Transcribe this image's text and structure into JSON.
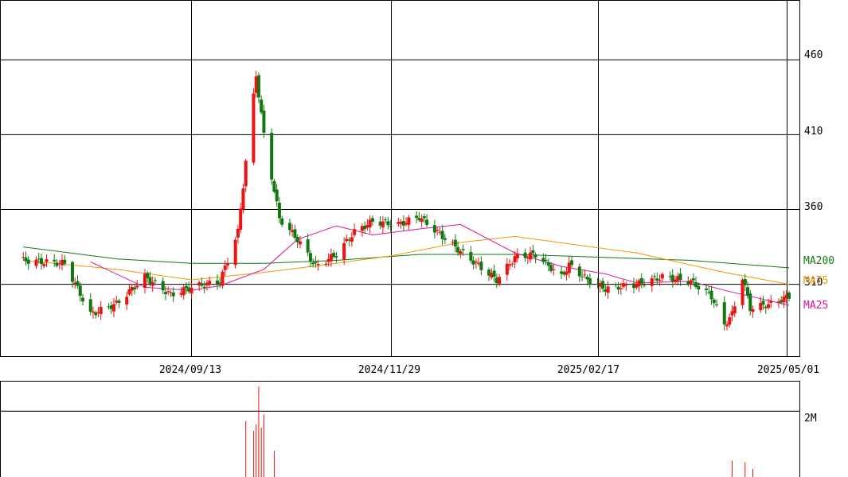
{
  "chart_data": {
    "type": "candlestick",
    "price_axis": {
      "ylim": [
        262,
        500
      ],
      "ticks": [
        310,
        360,
        410,
        460
      ]
    },
    "date_ticks": [
      "2024/09/13",
      "2024/11/29",
      "2025/02/17",
      "2025/05/01"
    ],
    "volume_axis": {
      "ylim": [
        0,
        2900000
      ],
      "tick_value": 2000000,
      "tick_label": "2M"
    },
    "colors": {
      "up": "#ee1111",
      "down": "#117711",
      "ma25": "#dd1199",
      "ma75": "#ee9900",
      "ma200": "#117711"
    },
    "ma_labels": {
      "ma200": "MA200",
      "ma75": "MA75",
      "ma25": "MA25"
    },
    "segments": [
      {
        "date": "2024/07/10",
        "close": 326
      },
      {
        "date": "2024/07/26",
        "close": 324
      },
      {
        "date": "2024/08/05",
        "close": 290
      },
      {
        "date": "2024/08/15",
        "close": 297
      },
      {
        "date": "2024/08/26",
        "close": 315
      },
      {
        "date": "2024/09/05",
        "close": 303
      },
      {
        "date": "2024/09/13",
        "close": 308
      },
      {
        "date": "2024/09/24",
        "close": 312
      },
      {
        "date": "2024/10/01",
        "close": 345
      },
      {
        "date": "2024/10/04",
        "close": 392
      },
      {
        "date": "2024/10/08",
        "close": 450
      },
      {
        "date": "2024/10/11",
        "close": 410
      },
      {
        "date": "2024/10/17",
        "close": 354
      },
      {
        "date": "2024/10/24",
        "close": 340
      },
      {
        "date": "2024/10/31",
        "close": 322
      },
      {
        "date": "2024/11/08",
        "close": 330
      },
      {
        "date": "2024/11/15",
        "close": 345
      },
      {
        "date": "2024/11/22",
        "close": 352
      },
      {
        "date": "2024/12/02",
        "close": 350
      },
      {
        "date": "2024/12/10",
        "close": 355
      },
      {
        "date": "2024/12/17",
        "close": 345
      },
      {
        "date": "2024/12/26",
        "close": 332
      },
      {
        "date": "2025/01/09",
        "close": 313
      },
      {
        "date": "2025/01/16",
        "close": 328
      },
      {
        "date": "2025/01/24",
        "close": 330
      },
      {
        "date": "2025/02/03",
        "close": 315
      },
      {
        "date": "2025/02/06",
        "close": 323
      },
      {
        "date": "2025/02/13",
        "close": 313
      },
      {
        "date": "2025/02/20",
        "close": 307
      },
      {
        "date": "2025/03/04",
        "close": 310
      },
      {
        "date": "2025/03/14",
        "close": 315
      },
      {
        "date": "2025/03/25",
        "close": 312
      },
      {
        "date": "2025/04/02",
        "close": 302
      },
      {
        "date": "2025/04/07",
        "close": 283
      },
      {
        "date": "2025/04/10",
        "close": 290
      },
      {
        "date": "2025/04/14",
        "close": 315
      },
      {
        "date": "2025/04/17",
        "close": 294
      },
      {
        "date": "2025/04/25",
        "close": 297
      },
      {
        "date": "2025/05/02",
        "close": 302
      }
    ],
    "moving_averages": {
      "ma25": [
        {
          "date": "2024/08/05",
          "value": 325
        },
        {
          "date": "2024/08/26",
          "value": 308
        },
        {
          "date": "2024/09/13",
          "value": 306
        },
        {
          "date": "2024/09/24",
          "value": 309
        },
        {
          "date": "2024/10/11",
          "value": 320
        },
        {
          "date": "2024/10/24",
          "value": 340
        },
        {
          "date": "2024/11/08",
          "value": 349
        },
        {
          "date": "2024/11/22",
          "value": 343
        },
        {
          "date": "2024/12/10",
          "value": 347
        },
        {
          "date": "2024/12/26",
          "value": 350
        },
        {
          "date": "2025/01/16",
          "value": 331
        },
        {
          "date": "2025/02/03",
          "value": 322
        },
        {
          "date": "2025/02/20",
          "value": 317
        },
        {
          "date": "2025/03/04",
          "value": 311
        },
        {
          "date": "2025/03/25",
          "value": 312
        },
        {
          "date": "2025/04/07",
          "value": 306
        },
        {
          "date": "2025/04/17",
          "value": 302
        },
        {
          "date": "2025/05/02",
          "value": 296
        }
      ],
      "ma75": [
        {
          "date": "2024/07/10",
          "value": 326
        },
        {
          "date": "2024/08/15",
          "value": 320
        },
        {
          "date": "2024/09/13",
          "value": 313
        },
        {
          "date": "2024/10/11",
          "value": 318
        },
        {
          "date": "2024/11/08",
          "value": 324
        },
        {
          "date": "2024/11/29",
          "value": 329
        },
        {
          "date": "2024/12/26",
          "value": 338
        },
        {
          "date": "2025/01/16",
          "value": 342
        },
        {
          "date": "2025/02/06",
          "value": 337
        },
        {
          "date": "2025/03/04",
          "value": 331
        },
        {
          "date": "2025/04/07",
          "value": 318
        },
        {
          "date": "2025/05/02",
          "value": 310
        }
      ],
      "ma200": [
        {
          "date": "2024/07/10",
          "value": 335
        },
        {
          "date": "2024/08/15",
          "value": 327
        },
        {
          "date": "2024/09/13",
          "value": 324
        },
        {
          "date": "2024/10/11",
          "value": 324
        },
        {
          "date": "2024/11/08",
          "value": 326
        },
        {
          "date": "2024/12/10",
          "value": 330
        },
        {
          "date": "2025/01/16",
          "value": 330
        },
        {
          "date": "2025/02/20",
          "value": 328
        },
        {
          "date": "2025/03/25",
          "value": 326
        },
        {
          "date": "2025/05/02",
          "value": 321
        }
      ]
    },
    "volume": [
      {
        "date": "2024/10/04",
        "value": 1700000
      },
      {
        "date": "2024/10/07",
        "value": 1400000
      },
      {
        "date": "2024/10/08",
        "value": 1600000
      },
      {
        "date": "2024/10/09",
        "value": 2750000
      },
      {
        "date": "2024/10/10",
        "value": 1500000
      },
      {
        "date": "2024/10/11",
        "value": 1900000
      },
      {
        "date": "2024/10/15",
        "value": 800000
      },
      {
        "date": "2024/04/14",
        "value": 2050000
      },
      {
        "date": "2025/04/10",
        "value": 500000
      },
      {
        "date": "2025/04/15",
        "value": 450000
      },
      {
        "date": "2025/04/18",
        "value": 250000
      }
    ]
  }
}
